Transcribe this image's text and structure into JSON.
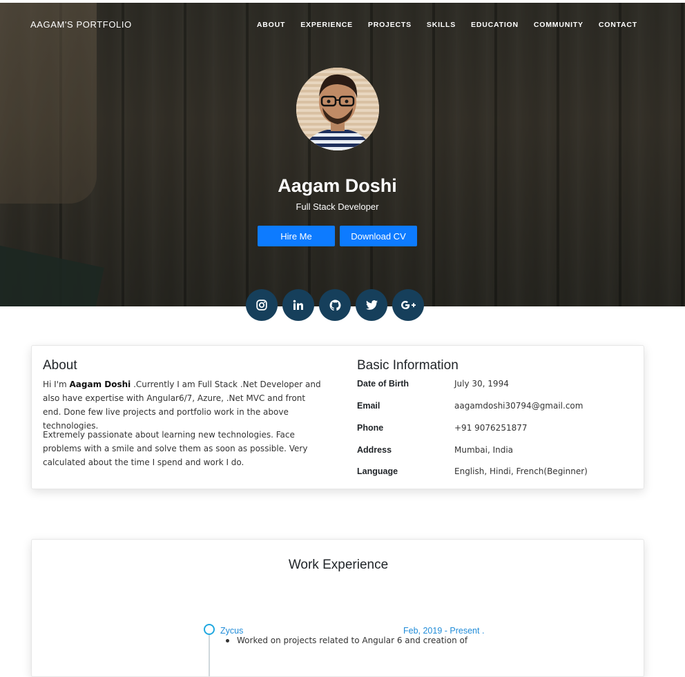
{
  "brand": "AAGAM'S PORTFOLIO",
  "nav": [
    "ABOUT",
    "EXPERIENCE",
    "PROJECTS",
    "SKILLS",
    "EDUCATION",
    "COMMUNITY",
    "CONTACT"
  ],
  "hero": {
    "name": "Aagam Doshi",
    "role": "Full Stack Developer",
    "hire_label": "Hire Me",
    "cv_label": "Download CV"
  },
  "social": [
    {
      "name": "instagram-icon"
    },
    {
      "name": "linkedin-icon"
    },
    {
      "name": "github-icon"
    },
    {
      "name": "twitter-icon"
    },
    {
      "name": "google-plus-icon"
    }
  ],
  "about": {
    "title": "About",
    "p1_pre": "Hi I'm ",
    "p1_name": "Aagam Doshi",
    "p1_post": " .Currently I am Full Stack .Net Developer and also have expertise with Angular6/7, Azure, .Net MVC and front end. Done few live projects and portfolio work in the above technologies.",
    "p2": "Extremely passionate about learning new technologies. Face problems with a smile and solve them as soon as possible. Very calculated about the time I spend and work I do."
  },
  "basic_info": {
    "title": "Basic Information",
    "rows": [
      {
        "label": "Date of Birth",
        "value": "July 30, 1994"
      },
      {
        "label": "Email",
        "value": "aagamdoshi30794@gmail.com"
      },
      {
        "label": "Phone",
        "value": "+91 9076251877"
      },
      {
        "label": "Address",
        "value": "Mumbai, India"
      },
      {
        "label": "Language",
        "value": "English, Hindi, French(Beginner)"
      }
    ]
  },
  "experience": {
    "title": "Work Experience",
    "items": [
      {
        "company": "Zycus",
        "date": "Feb, 2019 - Present .",
        "desc": "Worked on projects related to Angular 6 and creation of"
      }
    ]
  },
  "colors": {
    "accent": "#0d7bff",
    "social_bg": "#163f5b",
    "timeline": "#1fa8e0"
  }
}
